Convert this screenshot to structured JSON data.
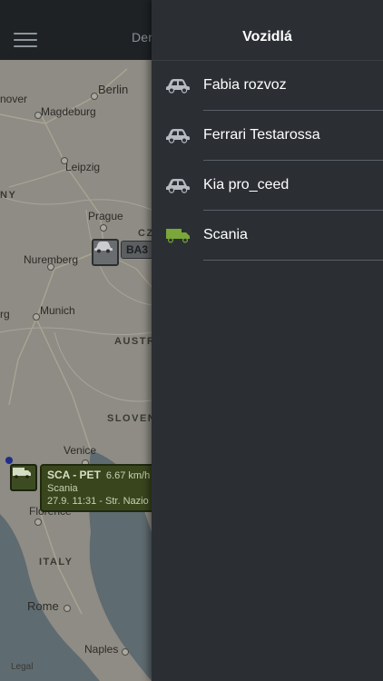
{
  "header": {
    "title_partial": "Der"
  },
  "map": {
    "cities": [
      {
        "name": "Berlin",
        "size": "big"
      },
      {
        "name": "Magdeburg"
      },
      {
        "name": "nover"
      },
      {
        "name": "Leipzig"
      },
      {
        "name": "Prague"
      },
      {
        "name": "Nuremberg"
      },
      {
        "name": "Munich"
      },
      {
        "name": "rg"
      },
      {
        "name": "Venice"
      },
      {
        "name": "Florence"
      },
      {
        "name": "Rome",
        "size": "big"
      },
      {
        "name": "Naples"
      }
    ],
    "countries": [
      "NY",
      "CZ",
      "AUSTR",
      "SLOVEN",
      "ITALY"
    ],
    "legal": "Legal",
    "markers": {
      "car_plate": "BA3",
      "truck": {
        "plate": "SCA - PET",
        "speed": "6.67 km/h",
        "name": "Scania",
        "status": "27.9. 11:31 - Str. Nazio"
      }
    },
    "colors": {
      "land": "#8e8c84",
      "sea": "#5d6a6f",
      "truck_marker": "#3d4b22"
    }
  },
  "drawer": {
    "title": "Vozidlá",
    "vehicles": [
      {
        "label": "Fabia rozvoz",
        "icon": "car-icon",
        "color": "#b7bcc2"
      },
      {
        "label": "Ferrari Testarossa",
        "icon": "car-icon",
        "color": "#b7bcc2"
      },
      {
        "label": "Kia pro_ceed",
        "icon": "car-icon",
        "color": "#b7bcc2"
      },
      {
        "label": "Scania",
        "icon": "truck-icon",
        "color": "#7aa63a"
      }
    ]
  }
}
